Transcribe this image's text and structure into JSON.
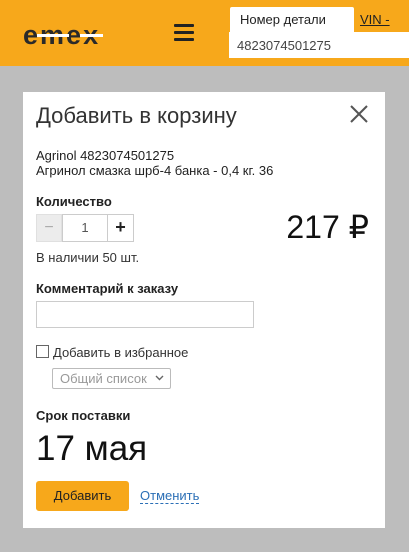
{
  "header": {
    "logo": "e·m·e·x",
    "search_tab_label": "Номер детали",
    "vin_tab_label": "VIN - номер",
    "search_value": "4823074501275"
  },
  "modal": {
    "title": "Добавить в корзину",
    "product_brand_code": "Agrinol 4823074501275",
    "product_description": "Агринол смазка шрб-4 банка - 0,4 кг. 36",
    "quantity_label": "Количество",
    "quantity_value": "1",
    "minus_label": "−",
    "plus_label": "+",
    "price": "217 ₽",
    "stock_text": "В наличии 50 шт.",
    "comment_label": "Комментарий к заказу",
    "comment_value": "",
    "favorite_label": "Добавить в избранное",
    "favorite_list_selected": "Общий список",
    "delivery_label": "Срок поставки",
    "delivery_date": "17 мая",
    "add_button": "Добавить",
    "cancel_link": "Отменить"
  },
  "colors": {
    "brand_orange": "#f7a81b",
    "link_blue": "#2b6fb6",
    "overlay_gray": "#bdbdbd"
  }
}
